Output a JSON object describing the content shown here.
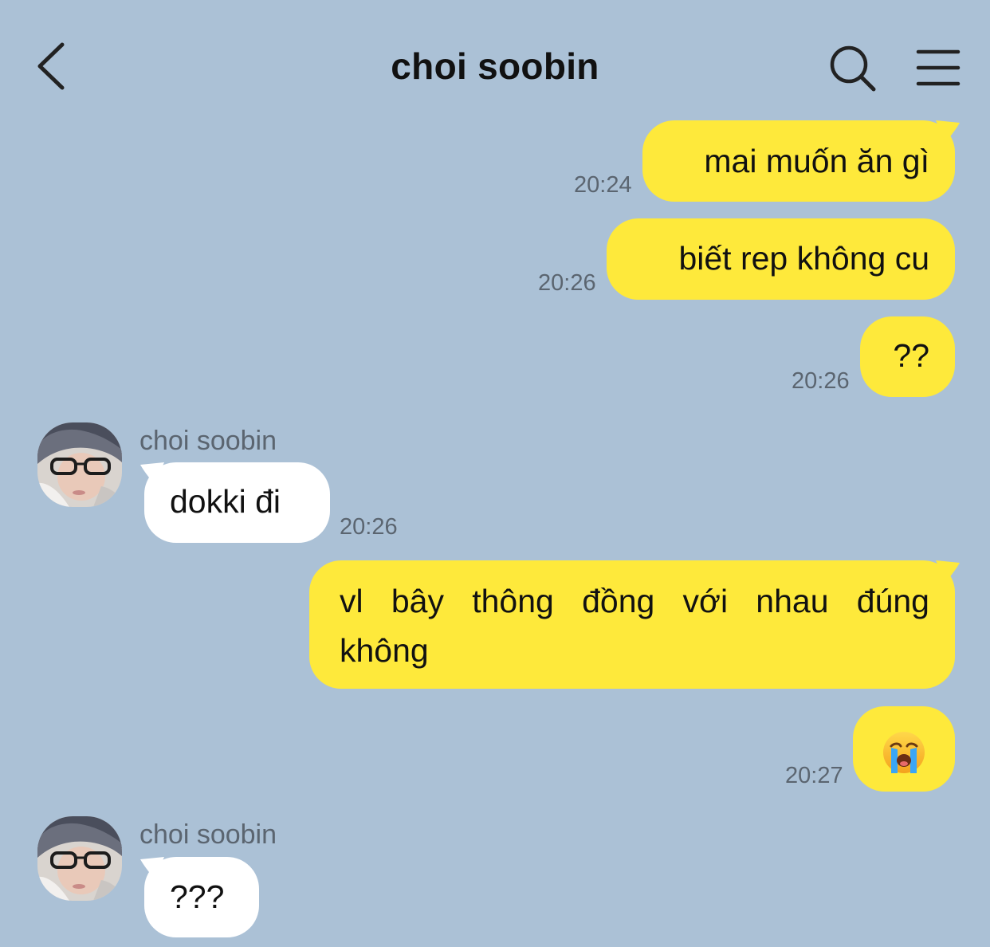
{
  "header": {
    "title": "choi soobin",
    "back_icon": "chevron-left-icon",
    "search_icon": "search-icon",
    "menu_icon": "hamburger-menu-icon"
  },
  "colors": {
    "background": "#abc1d6",
    "outgoing_bubble": "#fee93b",
    "incoming_bubble": "#ffffff",
    "timestamp": "#5b6570"
  },
  "messages": [
    {
      "direction": "out",
      "text": "mai muốn ăn gì",
      "time": "20:24"
    },
    {
      "direction": "out",
      "text": "biết rep không cu",
      "time": "20:26"
    },
    {
      "direction": "out",
      "text": "??",
      "time": "20:26"
    },
    {
      "direction": "in",
      "sender": "choi soobin",
      "text": "dokki đi",
      "time": "20:26"
    },
    {
      "direction": "out",
      "text_line1": "vl bây thông đồng với nhau đúng",
      "text_line2": "không",
      "time": ""
    },
    {
      "direction": "out",
      "text": "😭",
      "time": "20:27"
    },
    {
      "direction": "in",
      "sender": "choi soobin",
      "text": "???",
      "time": ""
    }
  ]
}
